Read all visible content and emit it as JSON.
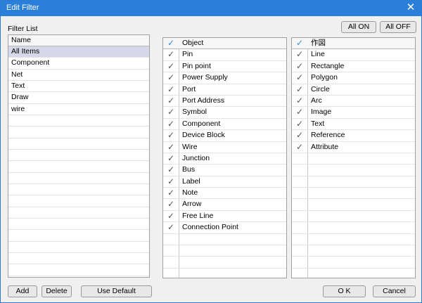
{
  "window": {
    "title": "Edit Filter"
  },
  "toolbar": {
    "all_on": "All ON",
    "all_off": "All OFF"
  },
  "filter_list": {
    "label": "Filter List",
    "column_header": "Name",
    "items": [
      "All Items",
      "Component",
      "Net",
      "Text",
      "Draw",
      "wire"
    ],
    "selected_index": 0
  },
  "objects": {
    "header": "Object",
    "items": [
      "Pin",
      "Pin point",
      "Power Supply",
      "Port",
      "Port Address",
      "Symbol",
      "Component",
      "Device Block",
      "Wire",
      "Junction",
      "Bus",
      "Label",
      "Note",
      "Arrow",
      "Free Line",
      "Connection Point"
    ]
  },
  "drawing": {
    "header": "作図",
    "items": [
      "Line",
      "Rectangle",
      "Polygon",
      "Circle",
      "Arc",
      "Image",
      "Text",
      "Reference",
      "Attribute"
    ]
  },
  "buttons": {
    "add": "Add",
    "delete": "Delete",
    "use_default": "Use Default",
    "ok": "O K",
    "cancel": "Cancel"
  },
  "icons": {
    "check": "✓",
    "close": "✕"
  },
  "colors": {
    "titlebar": "#2b7fd8",
    "selected_row": "#d7d7ea",
    "header_check": "#3b8ed8"
  }
}
